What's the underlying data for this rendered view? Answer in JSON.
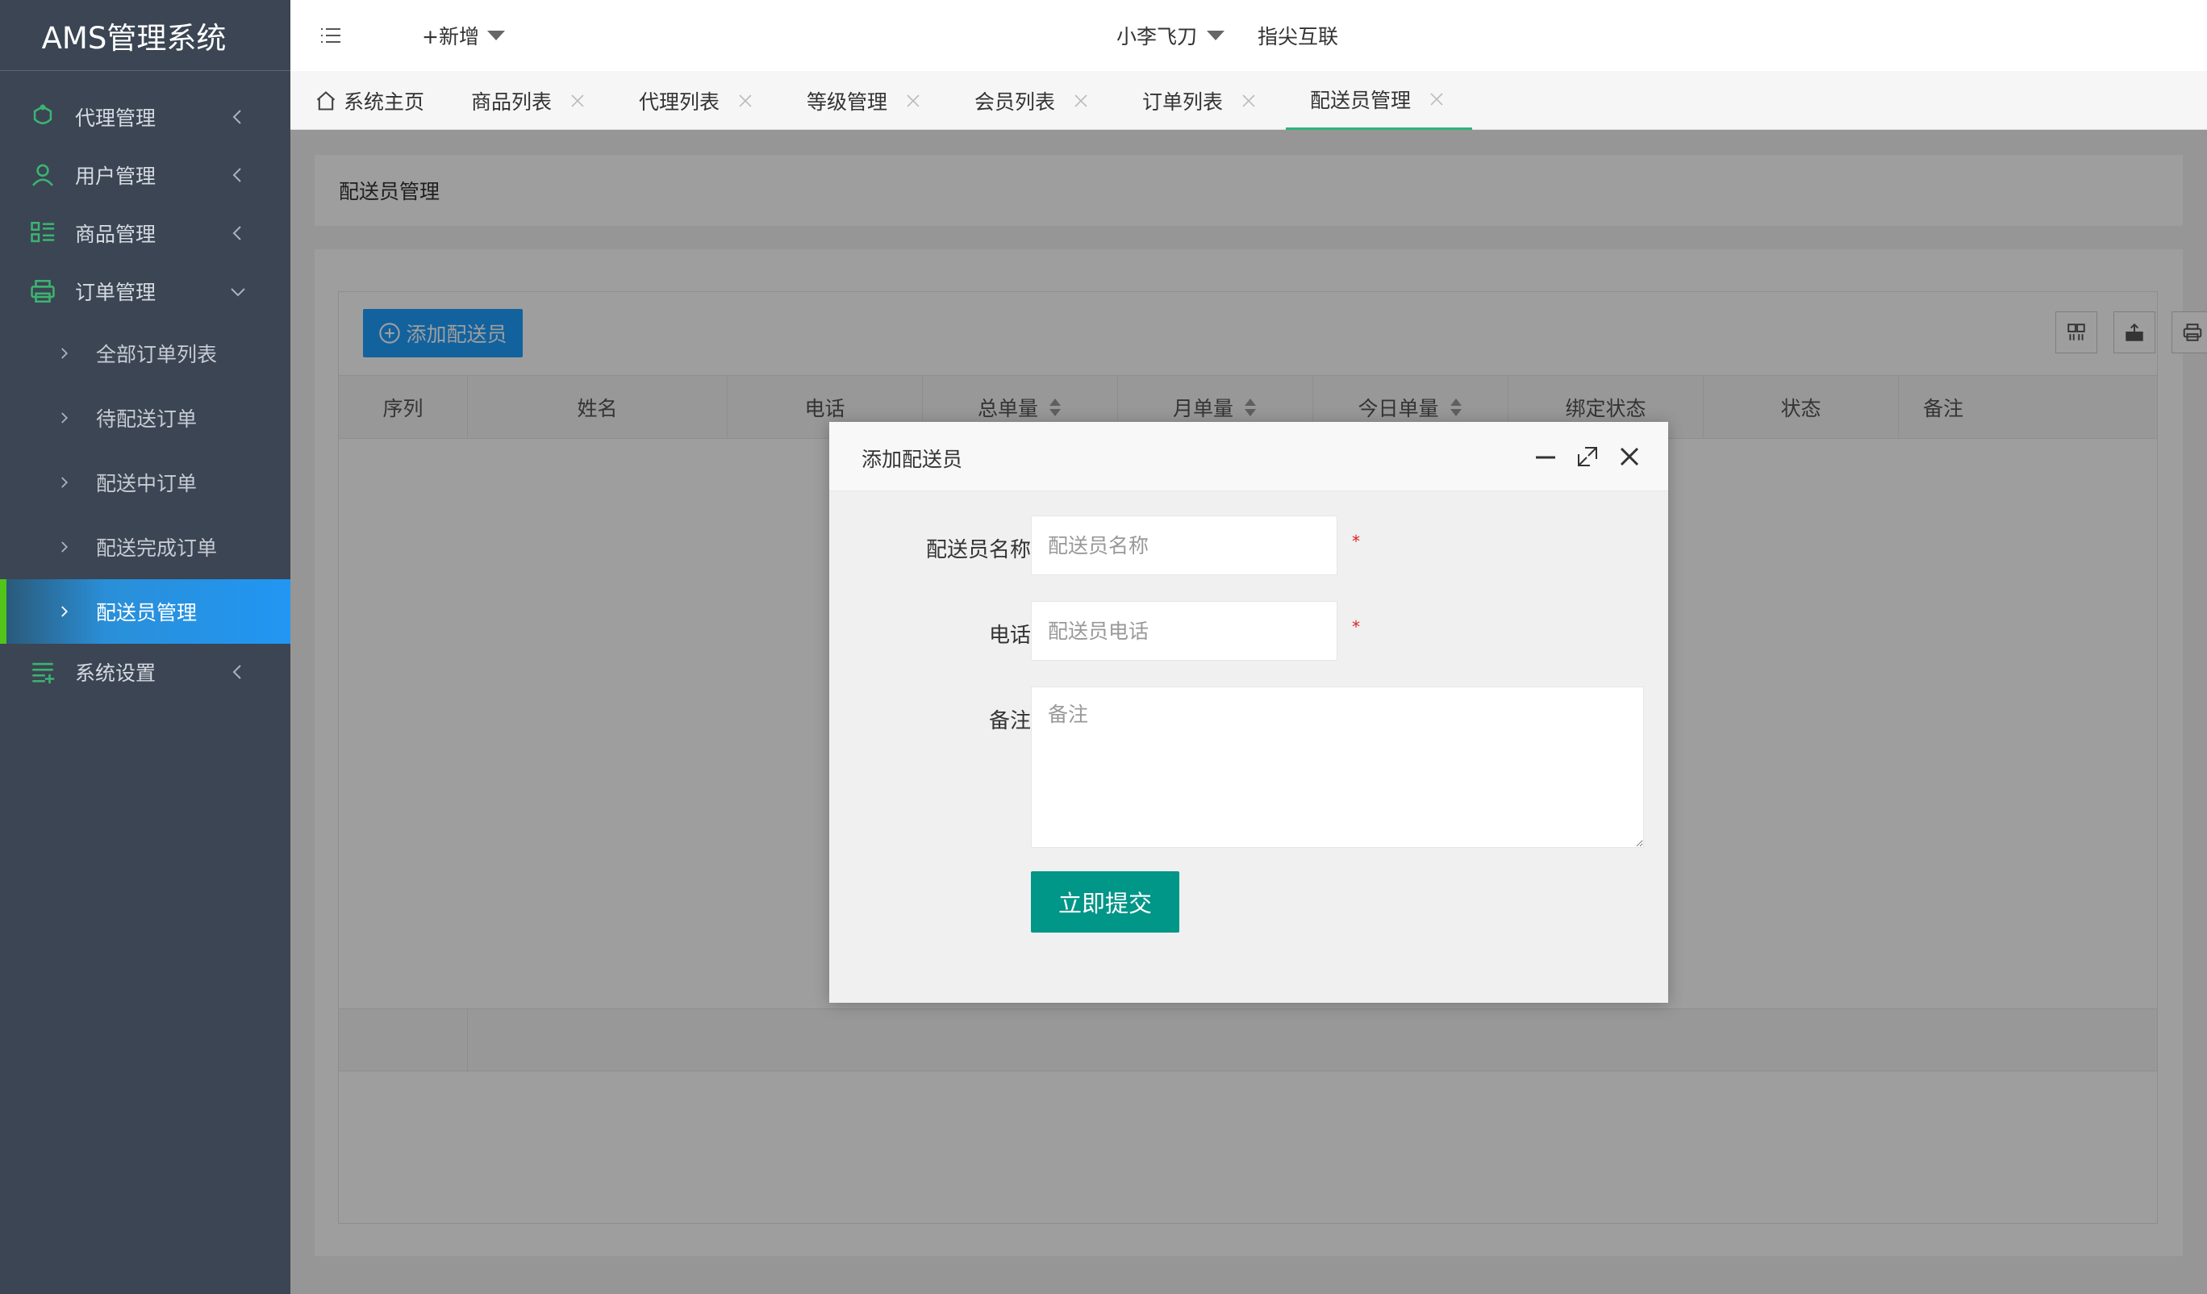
{
  "app": {
    "title": "AMS管理系统"
  },
  "header": {
    "new_label": "+新增",
    "user_name": "小李飞刀",
    "brand_link": "指尖互联"
  },
  "sidebar": {
    "items": [
      {
        "label": "代理管理",
        "icon": "agent-icon",
        "expanded": false
      },
      {
        "label": "用户管理",
        "icon": "user-icon",
        "expanded": false
      },
      {
        "label": "商品管理",
        "icon": "goods-icon",
        "expanded": false
      },
      {
        "label": "订单管理",
        "icon": "order-icon",
        "expanded": true,
        "children": [
          {
            "label": "全部订单列表"
          },
          {
            "label": "待配送订单"
          },
          {
            "label": "配送中订单"
          },
          {
            "label": "配送完成订单"
          },
          {
            "label": "配送员管理",
            "active": true
          }
        ]
      },
      {
        "label": "系统设置",
        "icon": "settings-icon",
        "expanded": false
      }
    ]
  },
  "tabs": [
    {
      "label": "系统主页",
      "closable": false
    },
    {
      "label": "商品列表",
      "closable": true
    },
    {
      "label": "代理列表",
      "closable": true
    },
    {
      "label": "等级管理",
      "closable": true
    },
    {
      "label": "会员列表",
      "closable": true
    },
    {
      "label": "订单列表",
      "closable": true
    },
    {
      "label": "配送员管理",
      "closable": true,
      "active": true
    }
  ],
  "page": {
    "breadcrumb": "配送员管理",
    "add_button_label": "添加配送员",
    "table": {
      "columns": [
        "序列",
        "姓名",
        "电话",
        "总单量",
        "月单量",
        "今日单量",
        "绑定状态",
        "状态",
        "备注"
      ],
      "rows": []
    }
  },
  "dialog": {
    "title": "添加配送员",
    "fields": {
      "name": {
        "label": "配送员名称",
        "placeholder": "配送员名称",
        "value": "",
        "required": true
      },
      "phone": {
        "label": "电话",
        "placeholder": "配送员电话",
        "value": "",
        "required": true
      },
      "remark": {
        "label": "备注",
        "placeholder": "备注",
        "value": ""
      }
    },
    "required_mark": "*",
    "submit_label": "立即提交"
  },
  "colors": {
    "sidebar_bg": "#3b4553",
    "active_menu": "#2196f3",
    "active_indicator": "#52c41a",
    "primary_button": "#1e9fff",
    "submit_button": "#009688",
    "required": "#e02020"
  }
}
